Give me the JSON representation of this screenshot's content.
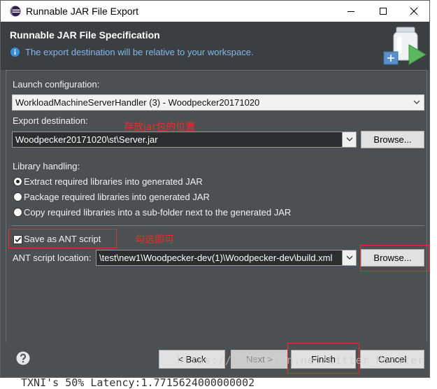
{
  "window": {
    "title": "Runnable JAR File Export",
    "icon": "eclipse-icon",
    "controls": [
      "minimize-icon",
      "maximize-icon",
      "close-icon"
    ]
  },
  "header": {
    "title": "Runnable JAR File Specification",
    "message": "The export destination will be relative to your workspace.",
    "message_icon": "info-icon",
    "banner_icon": "jar-export-icon"
  },
  "launch": {
    "label": "Launch configuration:",
    "value": "WorkloadMachineServerHandler (3) - Woodpecker20171020"
  },
  "export": {
    "label": "Export destination:",
    "value": "Woodpecker20171020\\st\\Server.jar",
    "browse_label": "Browse..."
  },
  "library": {
    "label": "Library handling:",
    "options": [
      {
        "label": "Extract required libraries into generated JAR",
        "selected": true
      },
      {
        "label": "Package required libraries into generated JAR",
        "selected": false
      },
      {
        "label": "Copy required libraries into a sub-folder next to the generated JAR",
        "selected": false
      }
    ]
  },
  "ant": {
    "save_label": "Save as ANT script",
    "checked": true,
    "location_label": "ANT script location:",
    "location_value": "\\test\\new1\\Woodpecker-dev(1)\\Woodpecker-dev\\build.xml",
    "browse_label": "Browse..."
  },
  "annotations": {
    "export_note": "存放jar包的位置",
    "ant_note": "勾选即可"
  },
  "footer": {
    "help_icon": "help-icon",
    "back": {
      "label": "< Back",
      "enabled": true
    },
    "next": {
      "label": "Next >",
      "enabled": false
    },
    "finish": {
      "label": "Finish",
      "enabled": true
    },
    "cancel": {
      "label": "Cancel",
      "enabled": true
    }
  },
  "watermark": "https://blog.csdn.net/Litter_Monster",
  "background_text": "TXNI's 50% Latency:1.7715624000000002",
  "colors": {
    "header_bg": "#3c3f41",
    "body_bg": "#4d5053",
    "annotation": "#e8302a",
    "info_text": "#82b7e8"
  }
}
